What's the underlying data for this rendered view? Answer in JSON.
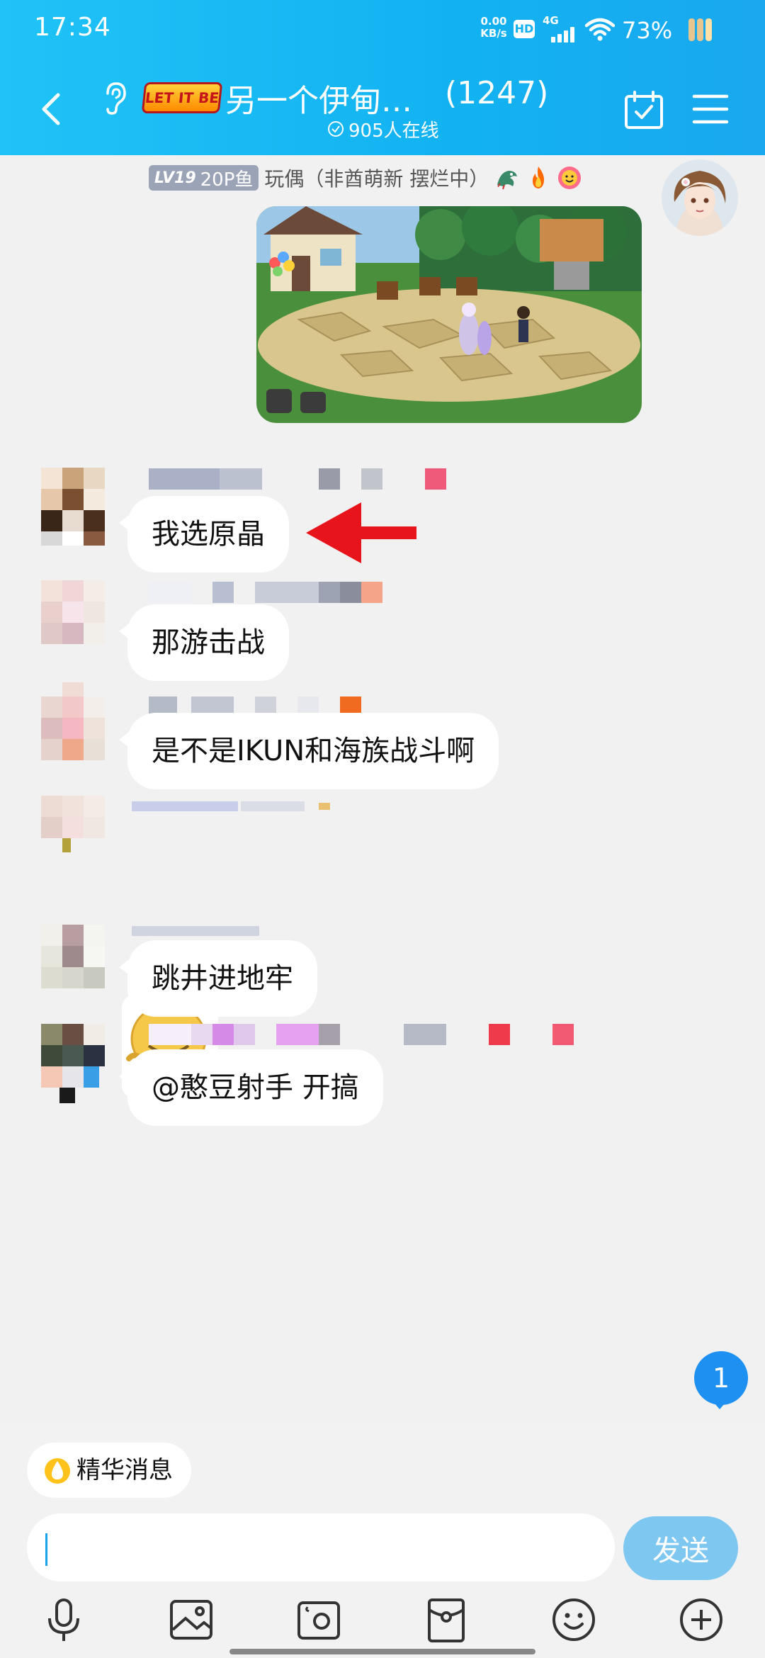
{
  "status_bar": {
    "time": "17:34",
    "net_speed_value": "0.00",
    "net_speed_unit": "KB/s",
    "hd": "HD",
    "network": "4G",
    "battery": "73%",
    "icons": [
      "wifi-icon",
      "signal-icon",
      "battery-icon"
    ]
  },
  "header": {
    "logo_text": "LET IT BE",
    "group_name": "另一个伊甸…",
    "member_count": "(1247)",
    "online": "905人在线",
    "colors": {
      "bar_start": "#1fc3f7",
      "bar_end": "#1aa8ee"
    }
  },
  "self_message": {
    "level": "LV19",
    "badge_label": "20P鱼",
    "sender": "玩偶（非酋萌新 摆烂中）"
  },
  "messages": [
    {
      "text": "我选原晶"
    },
    {
      "text": "那游击战"
    },
    {
      "text": "是不是IKUN和海族战斗啊"
    },
    {
      "text": "跳井进地牢"
    },
    {
      "text": "@憨豆射手 开搞"
    }
  ],
  "unread": "1",
  "input": {
    "essence_label": "精华消息",
    "placeholder": "",
    "send_label": "发送"
  },
  "toolbar": [
    "microphone-icon",
    "image-icon",
    "camera-icon",
    "red-packet-icon",
    "emoji-icon",
    "plus-icon"
  ],
  "colors": {
    "accent": "#12b2f1",
    "send_button": "#7ec7f0",
    "unread_badge": "#1e90f2",
    "arrow": "#e8141c"
  }
}
